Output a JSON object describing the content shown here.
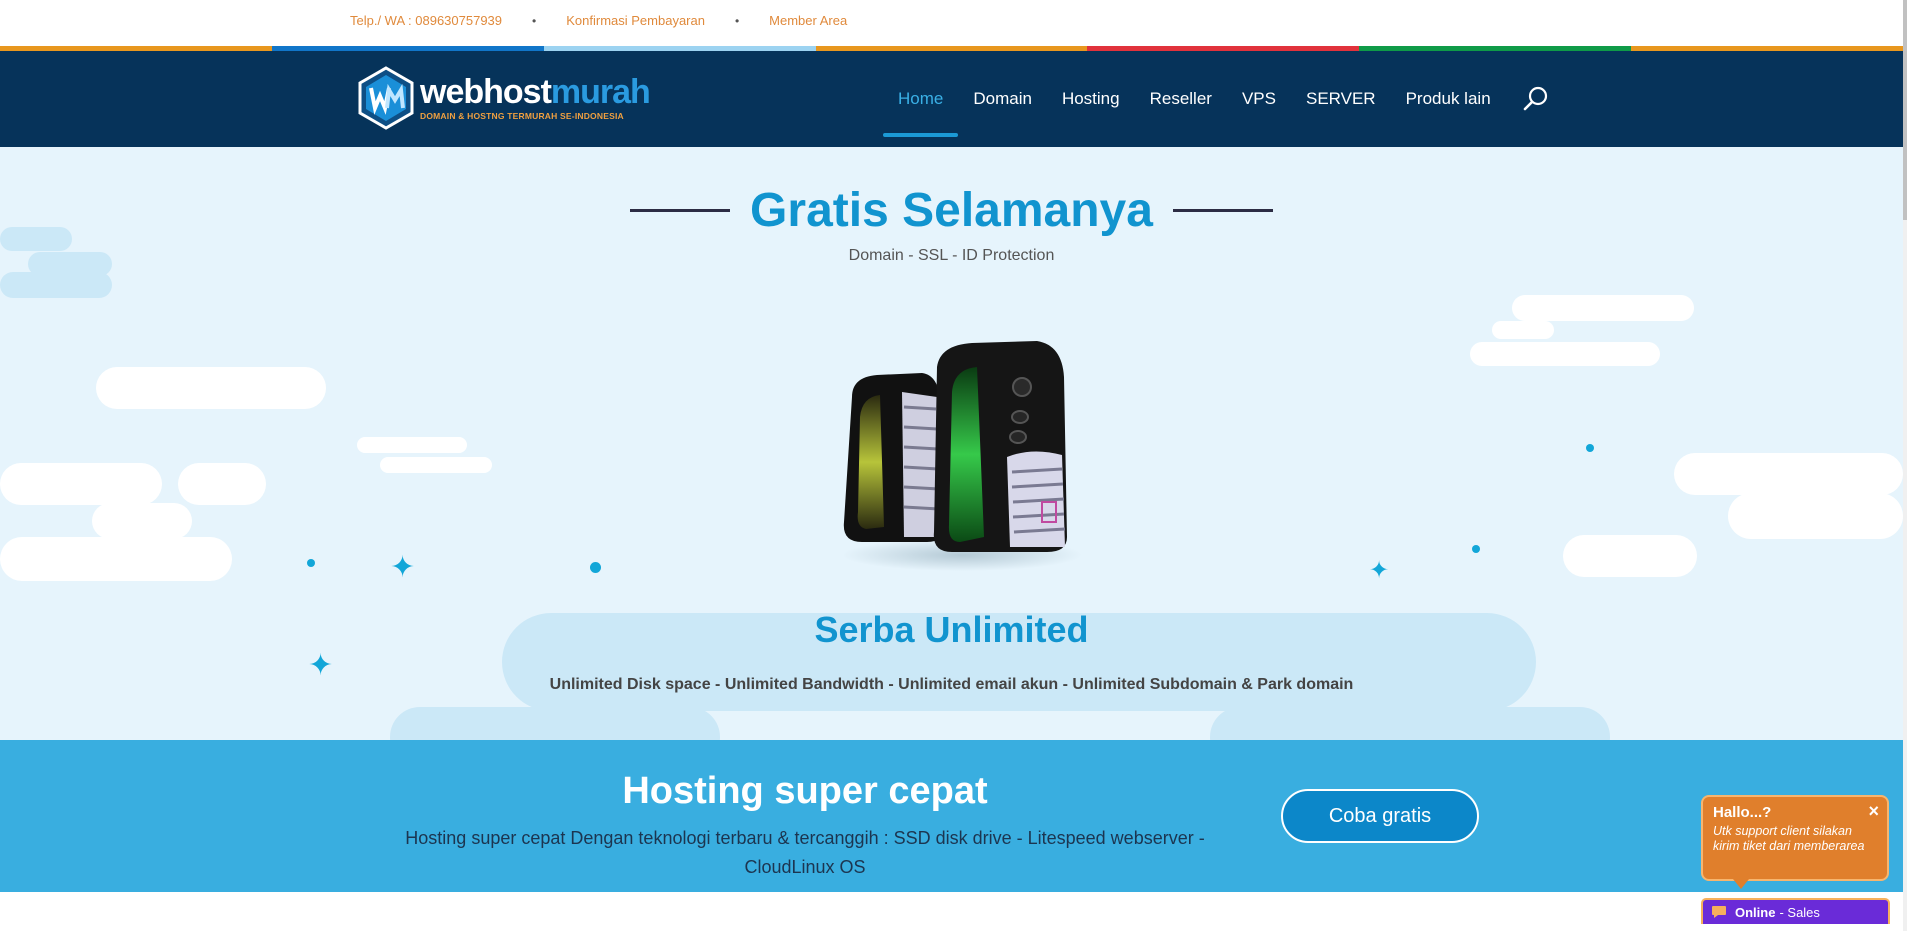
{
  "topbar": {
    "phone": "Telp./ WA : 089630757939",
    "confirm": "Konfirmasi Pembayaran",
    "member": "Member Area",
    "separator": "•"
  },
  "colors": {
    "strip": [
      "#e8971e",
      "#1176c9",
      "#9cd3f1",
      "#e8971e",
      "#e1323c",
      "#0f9b48",
      "#e8971e"
    ],
    "nav_bg": "#06335a",
    "accent": "#1194cf"
  },
  "logo": {
    "word_white": "webhost",
    "word_blue": "murah",
    "tagline": "DOMAIN & HOSTNG TERMURAH SE-INDONESIA"
  },
  "nav": {
    "items": [
      {
        "label": "Home"
      },
      {
        "label": "Domain"
      },
      {
        "label": "Hosting"
      },
      {
        "label": "Reseller"
      },
      {
        "label": "VPS"
      },
      {
        "label": "SERVER"
      },
      {
        "label": "Produk lain"
      }
    ],
    "active": "Home",
    "search_icon": "search-icon"
  },
  "hero": {
    "title": "Gratis Selamanya",
    "subtitle": "Domain - SSL - ID Protection",
    "unlimited_title": "Serba Unlimited",
    "unlimited_sub": "Unlimited Disk space - Unlimited Bandwidth - Unlimited email akun - Unlimited Subdomain & Park domain"
  },
  "band": {
    "title": "Hosting super cepat",
    "line1": "Hosting super cepat Dengan teknologi terbaru & tercanggih : SSD disk drive - Litespeed webserver -",
    "line2": "CloudLinux OS",
    "cta": "Coba gratis"
  },
  "chat": {
    "title": "Hallo...?",
    "text": "Utk support client silakan kirim tiket dari memberarea",
    "close": "×",
    "status": "Online",
    "dept": "- Sales"
  }
}
